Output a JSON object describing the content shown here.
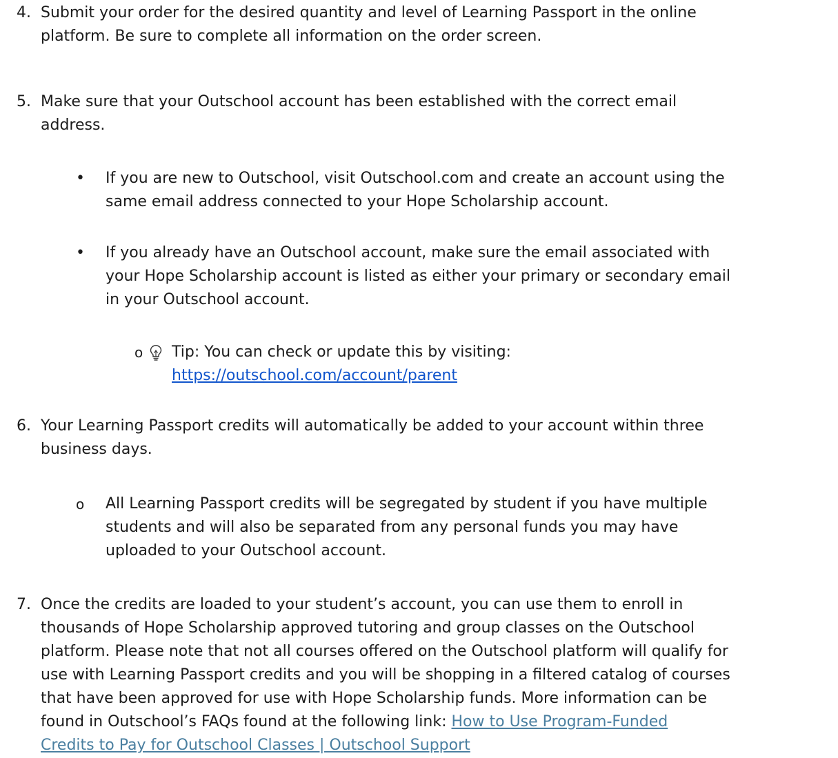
{
  "items": [
    {
      "number": "4.",
      "lines": [
        "Submit your order for the desired quantity and level of Learning Passport in the online",
        "platform.  Be sure to complete all information on the order screen."
      ]
    },
    {
      "number": "5.",
      "lines": [
        "Make sure that your Outschool account has been established with the correct email",
        "address."
      ],
      "bullets": [
        {
          "marker": "•",
          "lines": [
            "If you are new to Outschool, visit Outschool.com and create an account using the",
            "same email address connected to your Hope Scholarship account."
          ]
        },
        {
          "marker": "•",
          "lines": [
            "If you already have an Outschool account, make sure the email associated with",
            "your Hope Scholarship account is listed as either your primary or secondary email",
            "in your Outschool account."
          ]
        }
      ],
      "tip": {
        "marker": "o",
        "text": "Tip: You can check or update this by visiting:",
        "link": "https://outschool.com/account/parent"
      }
    },
    {
      "number": "6.",
      "lines": [
        "Your Learning Passport credits will automatically be added to your account within three",
        "business days."
      ],
      "sub": {
        "marker": "o",
        "lines": [
          "All Learning Passport credits will be segregated by student if you have multiple",
          "students and will also be separated from any personal funds you may have",
          "uploaded to your Outschool account."
        ]
      }
    },
    {
      "number": "7.",
      "lines": [
        "Once the credits are loaded to your student’s account, you can use them to enroll in",
        "thousands of Hope Scholarship approved tutoring and group classes on the Outschool",
        "platform.  Please note that not all courses offered on the Outschool platform will qualify for",
        "use with Learning Passport credits and you will be shopping in a filtered catalog of courses",
        "that have been approved for use with Hope Scholarship funds.  More information can be",
        "found in Outschool’s FAQs found at the following link:  "
      ],
      "link_line1": "How to Use Program-Funded",
      "link_line2": "Credits to Pay for Outschool Classes | Outschool Support"
    }
  ]
}
